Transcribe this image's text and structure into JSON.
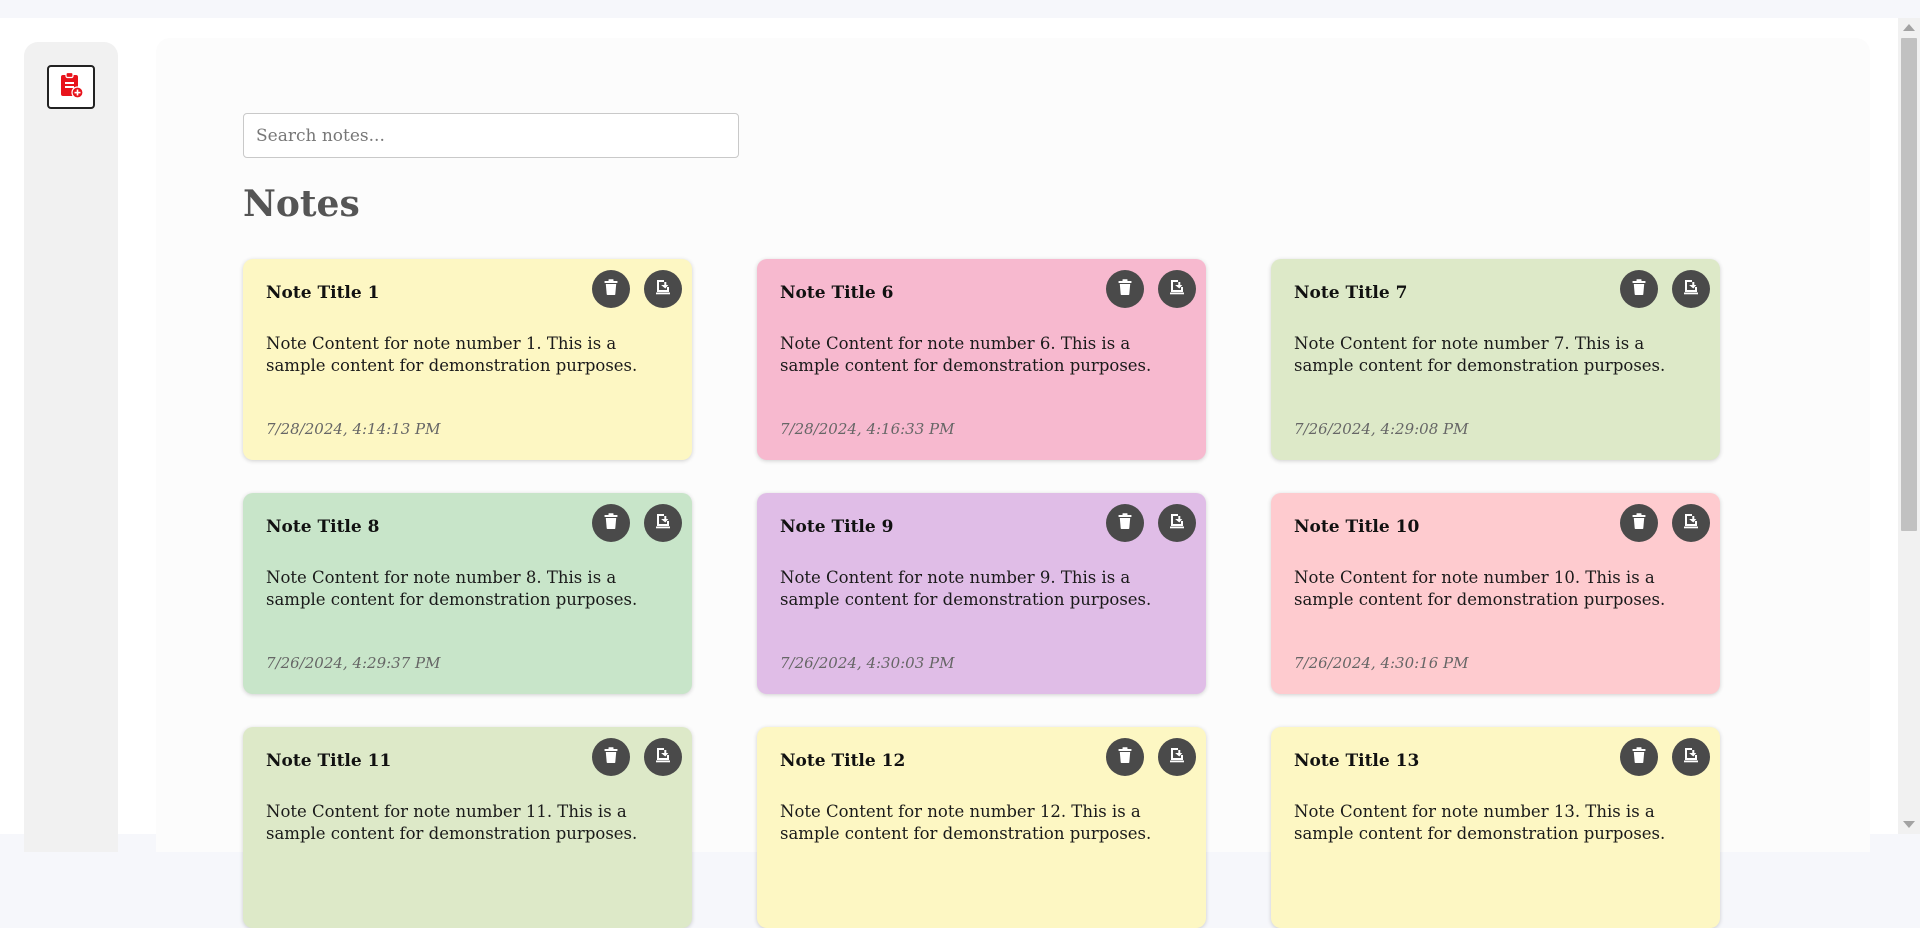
{
  "search": {
    "placeholder": "Search notes..."
  },
  "page": {
    "title": "Notes"
  },
  "sidebar": {
    "add_note_icon": "clipboard-plus-icon",
    "accent": "#e8131b"
  },
  "note_actions": {
    "delete_icon": "trash-icon",
    "download_icon": "download-icon",
    "button_color": "#4a4a4a"
  },
  "notes": [
    {
      "title": "Note Title 1",
      "content": "Note Content for note number 1. This is a sample content for demonstration purposes.",
      "date": "7/28/2024, 4:14:13 PM",
      "color": "#fdf7c3"
    },
    {
      "title": "Note Title 6",
      "content": "Note Content for note number 6. This is a sample content for demonstration purposes.",
      "date": "7/28/2024, 4:16:33 PM",
      "color": "#f7b9cf"
    },
    {
      "title": "Note Title 7",
      "content": "Note Content for note number 7. This is a sample content for demonstration purposes.",
      "date": "7/26/2024, 4:29:08 PM",
      "color": "#dde9c8"
    },
    {
      "title": "Note Title 8",
      "content": "Note Content for note number 8. This is a sample content for demonstration purposes.",
      "date": "7/26/2024, 4:29:37 PM",
      "color": "#c8e5c9"
    },
    {
      "title": "Note Title 9",
      "content": "Note Content for note number 9. This is a sample content for demonstration purposes.",
      "date": "7/26/2024, 4:30:03 PM",
      "color": "#e0bde7"
    },
    {
      "title": "Note Title 10",
      "content": "Note Content for note number 10. This is a sample content for demonstration purposes.",
      "date": "7/26/2024, 4:30:16 PM",
      "color": "#fecbcf"
    },
    {
      "title": "Note Title 11",
      "content": "Note Content for note number 11. This is a sample content for demonstration purposes.",
      "date": "",
      "color": "#dde9c8"
    },
    {
      "title": "Note Title 12",
      "content": "Note Content for note number 12. This is a sample content for demonstration purposes.",
      "date": "",
      "color": "#fdf7c3"
    },
    {
      "title": "Note Title 13",
      "content": "Note Content for note number 13. This is a sample content for demonstration purposes.",
      "date": "",
      "color": "#fdf7c3"
    }
  ]
}
